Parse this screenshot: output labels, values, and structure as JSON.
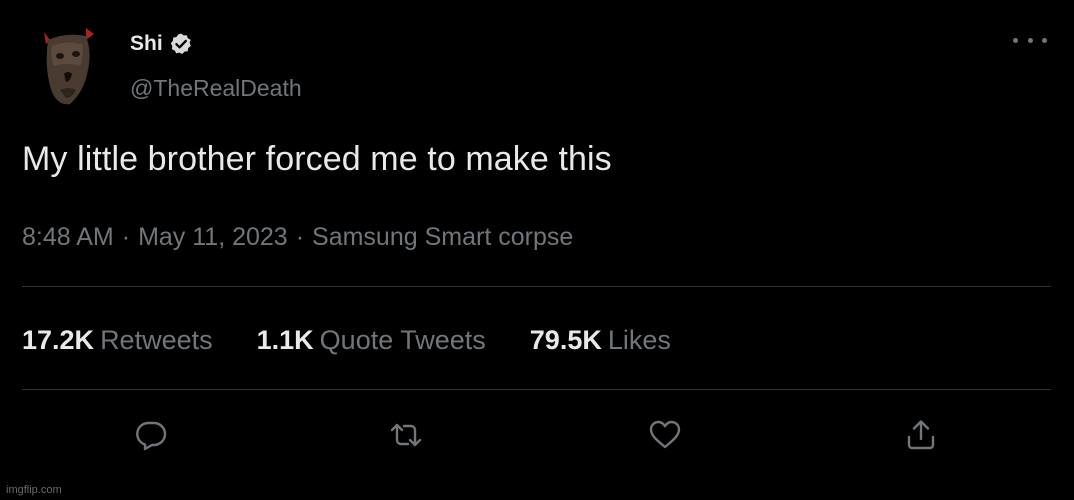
{
  "user": {
    "display_name": "Shi",
    "handle": "@TheRealDeath",
    "verified": true,
    "avatar_icon": "skull-mask-avatar"
  },
  "tweet": {
    "text": "My little brother forced me to make this",
    "time": "8:48 AM",
    "date": "May 11, 2023",
    "separator": "·",
    "source": "Samsung Smart corpse"
  },
  "stats": {
    "retweets": {
      "count": "17.2K",
      "label": "Retweets"
    },
    "quotes": {
      "count": "1.1K",
      "label": "Quote Tweets"
    },
    "likes": {
      "count": "79.5K",
      "label": "Likes"
    }
  },
  "actions": [
    "reply-icon",
    "retweet-icon",
    "like-icon",
    "share-icon"
  ],
  "watermark": "imgflip.com",
  "colors": {
    "background": "#000000",
    "primary_text": "#e7e9ea",
    "secondary_text": "#71767b",
    "divider": "#2f3336",
    "verified_badge": "#d9d9d9"
  }
}
